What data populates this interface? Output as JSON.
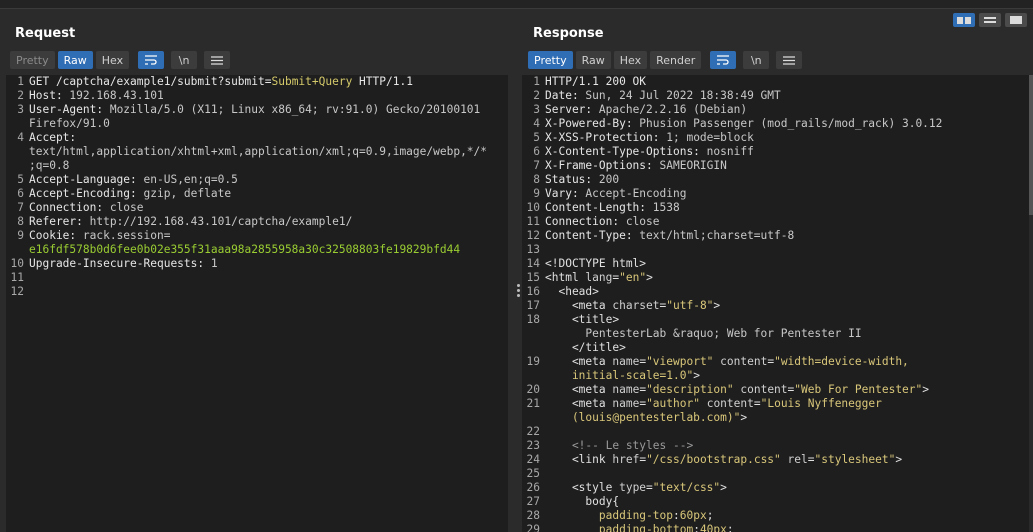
{
  "request": {
    "title": "Request",
    "tabs": [
      "Pretty",
      "Raw",
      "Hex"
    ],
    "active_tab": "Raw",
    "newline_label": "\\n",
    "lines": [
      {
        "n": "1",
        "parts": [
          [
            "k-key",
            "GET /captcha/example1/submit?submit="
          ],
          [
            "k-param",
            "Submit+Query"
          ],
          [
            "k-key",
            " HTTP/1.1"
          ]
        ]
      },
      {
        "n": "2",
        "parts": [
          [
            "k-key",
            "Host: "
          ],
          [
            "k-val",
            "192.168.43.101"
          ]
        ]
      },
      {
        "n": "3",
        "parts": [
          [
            "k-key",
            "User-Agent: "
          ],
          [
            "k-val",
            "Mozilla/5.0 (X11; Linux x86_64; rv:91.0) Gecko/20100101"
          ]
        ]
      },
      {
        "n": "",
        "parts": [
          [
            "k-val",
            "Firefox/91.0"
          ]
        ]
      },
      {
        "n": "4",
        "parts": [
          [
            "k-key",
            "Accept: "
          ]
        ]
      },
      {
        "n": "",
        "parts": [
          [
            "k-val",
            "text/html,application/xhtml+xml,application/xml;q=0.9,image/webp,*/*"
          ]
        ]
      },
      {
        "n": "",
        "parts": [
          [
            "k-val",
            ";q=0.8"
          ]
        ]
      },
      {
        "n": "5",
        "parts": [
          [
            "k-key",
            "Accept-Language: "
          ],
          [
            "k-val",
            "en-US,en;q=0.5"
          ]
        ]
      },
      {
        "n": "6",
        "parts": [
          [
            "k-key",
            "Accept-Encoding: "
          ],
          [
            "k-val",
            "gzip, deflate"
          ]
        ]
      },
      {
        "n": "7",
        "parts": [
          [
            "k-key",
            "Connection: "
          ],
          [
            "k-val",
            "close"
          ]
        ]
      },
      {
        "n": "8",
        "parts": [
          [
            "k-key",
            "Referer: "
          ],
          [
            "k-val",
            "http://192.168.43.101/captcha/example1/"
          ]
        ]
      },
      {
        "n": "9",
        "parts": [
          [
            "k-key",
            "Cookie: "
          ],
          [
            "k-val",
            "rack.session="
          ]
        ]
      },
      {
        "n": "",
        "parts": [
          [
            "k-cookie",
            "e16fdf578b0d6fee0b02e355f31aaa98a2855958a30c32508803fe19829bfd44"
          ]
        ]
      },
      {
        "n": "10",
        "parts": [
          [
            "k-key",
            "Upgrade-Insecure-Requests: "
          ],
          [
            "k-val",
            "1"
          ]
        ]
      },
      {
        "n": "11",
        "parts": []
      },
      {
        "n": "12",
        "parts": []
      }
    ]
  },
  "response": {
    "title": "Response",
    "tabs": [
      "Pretty",
      "Raw",
      "Hex",
      "Render"
    ],
    "active_tab": "Pretty",
    "newline_label": "\\n",
    "lines": [
      {
        "n": "1",
        "parts": [
          [
            "k-key",
            "HTTP/1.1 200 OK"
          ]
        ]
      },
      {
        "n": "2",
        "parts": [
          [
            "k-key",
            "Date: "
          ],
          [
            "k-val",
            "Sun, 24 Jul 2022 18:38:49 GMT"
          ]
        ]
      },
      {
        "n": "3",
        "parts": [
          [
            "k-key",
            "Server: "
          ],
          [
            "k-val",
            "Apache/2.2.16 (Debian)"
          ]
        ]
      },
      {
        "n": "4",
        "parts": [
          [
            "k-key",
            "X-Powered-By: "
          ],
          [
            "k-val",
            "Phusion Passenger (mod_rails/mod_rack) 3.0.12"
          ]
        ]
      },
      {
        "n": "5",
        "parts": [
          [
            "k-key",
            "X-XSS-Protection: "
          ],
          [
            "k-val",
            "1; mode=block"
          ]
        ]
      },
      {
        "n": "6",
        "parts": [
          [
            "k-key",
            "X-Content-Type-Options: "
          ],
          [
            "k-val",
            "nosniff"
          ]
        ]
      },
      {
        "n": "7",
        "parts": [
          [
            "k-key",
            "X-Frame-Options: "
          ],
          [
            "k-val",
            "SAMEORIGIN"
          ]
        ]
      },
      {
        "n": "8",
        "parts": [
          [
            "k-key",
            "Status: "
          ],
          [
            "k-val",
            "200"
          ]
        ]
      },
      {
        "n": "9",
        "parts": [
          [
            "k-key",
            "Vary: "
          ],
          [
            "k-val",
            "Accept-Encoding"
          ]
        ]
      },
      {
        "n": "10",
        "parts": [
          [
            "k-key",
            "Content-Length: "
          ],
          [
            "k-val",
            "1538"
          ]
        ]
      },
      {
        "n": "11",
        "parts": [
          [
            "k-key",
            "Connection: "
          ],
          [
            "k-val",
            "close"
          ]
        ]
      },
      {
        "n": "12",
        "parts": [
          [
            "k-key",
            "Content-Type: "
          ],
          [
            "k-val",
            "text/html;charset=utf-8"
          ]
        ]
      },
      {
        "n": "13",
        "parts": []
      },
      {
        "n": "14",
        "parts": [
          [
            "t-tag",
            "<!DOCTYPE html>"
          ]
        ]
      },
      {
        "n": "15",
        "parts": [
          [
            "t-tag",
            "<html "
          ],
          [
            "t-attr",
            "lang"
          ],
          [
            "t-tag",
            "="
          ],
          [
            "t-str",
            "\"en\""
          ],
          [
            "t-tag",
            ">"
          ]
        ]
      },
      {
        "n": "16",
        "parts": [
          [
            "t-tag",
            "  <head>"
          ]
        ]
      },
      {
        "n": "17",
        "parts": [
          [
            "t-tag",
            "    <meta "
          ],
          [
            "t-attr",
            "charset"
          ],
          [
            "t-tag",
            "="
          ],
          [
            "t-str",
            "\"utf-8\""
          ],
          [
            "t-tag",
            ">"
          ]
        ]
      },
      {
        "n": "18",
        "parts": [
          [
            "t-tag",
            "    <title>"
          ]
        ]
      },
      {
        "n": "",
        "parts": [
          [
            "k-val",
            "      PentesterLab &raquo; Web for Pentester II"
          ]
        ]
      },
      {
        "n": "",
        "parts": [
          [
            "t-tag",
            "    </title>"
          ]
        ]
      },
      {
        "n": "19",
        "parts": [
          [
            "t-tag",
            "    <meta "
          ],
          [
            "t-attr",
            "name"
          ],
          [
            "t-tag",
            "="
          ],
          [
            "t-str",
            "\"viewport\""
          ],
          [
            "t-tag",
            " "
          ],
          [
            "t-attr",
            "content"
          ],
          [
            "t-tag",
            "="
          ],
          [
            "t-str",
            "\"width=device-width,"
          ]
        ]
      },
      {
        "n": "",
        "parts": [
          [
            "t-str",
            "    initial-scale=1.0\""
          ],
          [
            "t-tag",
            ">"
          ]
        ]
      },
      {
        "n": "20",
        "parts": [
          [
            "t-tag",
            "    <meta "
          ],
          [
            "t-attr",
            "name"
          ],
          [
            "t-tag",
            "="
          ],
          [
            "t-str",
            "\"description\""
          ],
          [
            "t-tag",
            " "
          ],
          [
            "t-attr",
            "content"
          ],
          [
            "t-tag",
            "="
          ],
          [
            "t-str",
            "\"Web For Pentester\""
          ],
          [
            "t-tag",
            ">"
          ]
        ]
      },
      {
        "n": "21",
        "parts": [
          [
            "t-tag",
            "    <meta "
          ],
          [
            "t-attr",
            "name"
          ],
          [
            "t-tag",
            "="
          ],
          [
            "t-str",
            "\"author\""
          ],
          [
            "t-tag",
            " "
          ],
          [
            "t-attr",
            "content"
          ],
          [
            "t-tag",
            "="
          ],
          [
            "t-str",
            "\"Louis Nyffenegger"
          ]
        ]
      },
      {
        "n": "",
        "parts": [
          [
            "t-str",
            "    (louis@pentesterlab.com)\""
          ],
          [
            "t-tag",
            ">"
          ]
        ]
      },
      {
        "n": "22",
        "parts": []
      },
      {
        "n": "23",
        "parts": [
          [
            "t-com",
            "    <!-- Le styles -->"
          ]
        ]
      },
      {
        "n": "24",
        "parts": [
          [
            "t-tag",
            "    <link "
          ],
          [
            "t-attr",
            "href"
          ],
          [
            "t-tag",
            "="
          ],
          [
            "t-str",
            "\"/css/bootstrap.css\""
          ],
          [
            "t-tag",
            " "
          ],
          [
            "t-attr",
            "rel"
          ],
          [
            "t-tag",
            "="
          ],
          [
            "t-str",
            "\"stylesheet\""
          ],
          [
            "t-tag",
            ">"
          ]
        ]
      },
      {
        "n": "25",
        "parts": []
      },
      {
        "n": "26",
        "parts": [
          [
            "t-tag",
            "    <style "
          ],
          [
            "t-attr",
            "type"
          ],
          [
            "t-tag",
            "="
          ],
          [
            "t-str",
            "\"text/css\""
          ],
          [
            "t-tag",
            ">"
          ]
        ]
      },
      {
        "n": "27",
        "parts": [
          [
            "t-tag",
            "      body{"
          ]
        ]
      },
      {
        "n": "28",
        "parts": [
          [
            "t-tag",
            "        "
          ],
          [
            "t-prop",
            "padding-top"
          ],
          [
            "t-tag",
            ":"
          ],
          [
            "t-str",
            "60px"
          ],
          [
            "t-tag",
            ";"
          ]
        ]
      },
      {
        "n": "29",
        "parts": [
          [
            "t-tag",
            "        "
          ],
          [
            "t-prop",
            "padding-bottom"
          ],
          [
            "t-tag",
            ":"
          ],
          [
            "t-str",
            "40px"
          ],
          [
            "t-tag",
            ";"
          ]
        ]
      }
    ]
  }
}
